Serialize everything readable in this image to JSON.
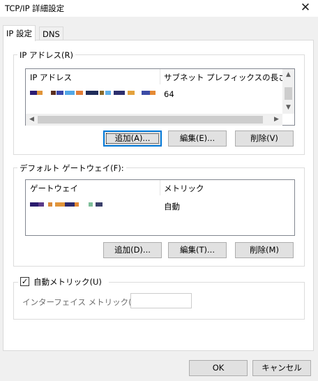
{
  "window": {
    "title": "TCP/IP 詳細設定",
    "close_icon": "close-icon"
  },
  "tabs": [
    {
      "label": "IP 設定",
      "active": true
    },
    {
      "label": "DNS",
      "active": false
    }
  ],
  "ip_section": {
    "label": "IP アドレス(R)",
    "columns": [
      "IP アドレス",
      "サブネット プレフィックスの長さ"
    ],
    "rows": [
      {
        "prefix_length": "64"
      }
    ],
    "buttons": {
      "add": "追加(A)...",
      "edit": "編集(E)...",
      "delete": "削除(V)"
    }
  },
  "gateway_section": {
    "label": "デフォルト ゲートウェイ(F):",
    "columns": [
      "ゲートウェイ",
      "メトリック"
    ],
    "rows": [
      {
        "metric": "自動"
      }
    ],
    "buttons": {
      "add": "追加(D)...",
      "edit": "編集(T)...",
      "delete": "削除(M)"
    }
  },
  "metric_section": {
    "auto_metric_label": "自動メトリック(U)",
    "auto_metric_checked": true,
    "interface_metric_label": "インターフェイス メトリック(N):",
    "interface_metric_value": ""
  },
  "footer": {
    "ok": "OK",
    "cancel": "キャンセル"
  },
  "colors": {
    "accent": "#0078d7",
    "background": "#f0f0f0",
    "panel": "#ffffff"
  }
}
